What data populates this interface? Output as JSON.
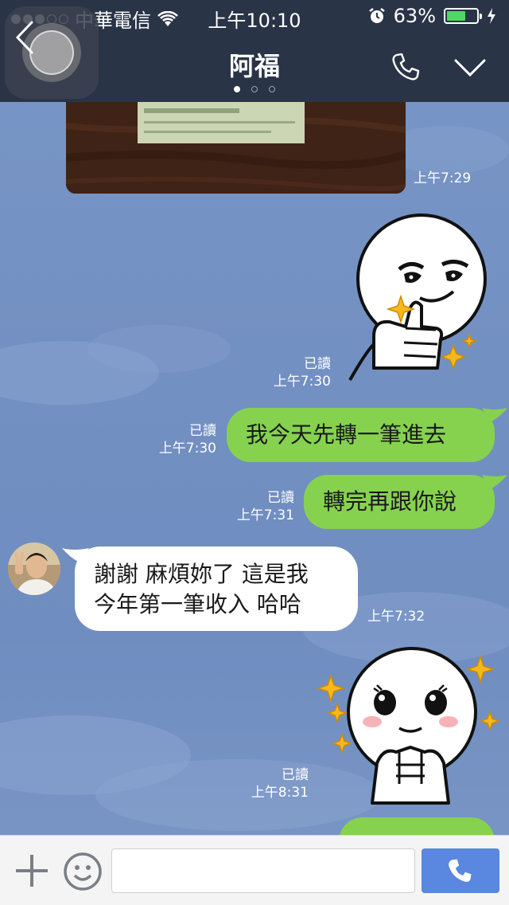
{
  "status_bar": {
    "carrier": "中華電信",
    "time": "上午10:10",
    "battery": "63%",
    "battery_level": 0.63
  },
  "header": {
    "title": "阿福"
  },
  "messages": {
    "photo_time": "上午7:29",
    "sticker1": {
      "read": "已讀",
      "time": "上午7:30"
    },
    "msg1": {
      "read": "已讀",
      "time": "上午7:30",
      "text": "我今天先轉一筆進去"
    },
    "msg2": {
      "read": "已讀",
      "time": "上午7:31",
      "text": "轉完再跟你說"
    },
    "incoming": {
      "line1": "謝謝 麻煩妳了 這是我",
      "line2": "今年第一筆收入 哈哈",
      "time": "上午7:32"
    },
    "sticker2": {
      "read": "已讀",
      "time": "上午8:31"
    }
  },
  "input": {
    "placeholder": ""
  },
  "colors": {
    "bar": "#2a3447",
    "sent_bubble": "#86d24f",
    "call_button": "#5a87df"
  }
}
